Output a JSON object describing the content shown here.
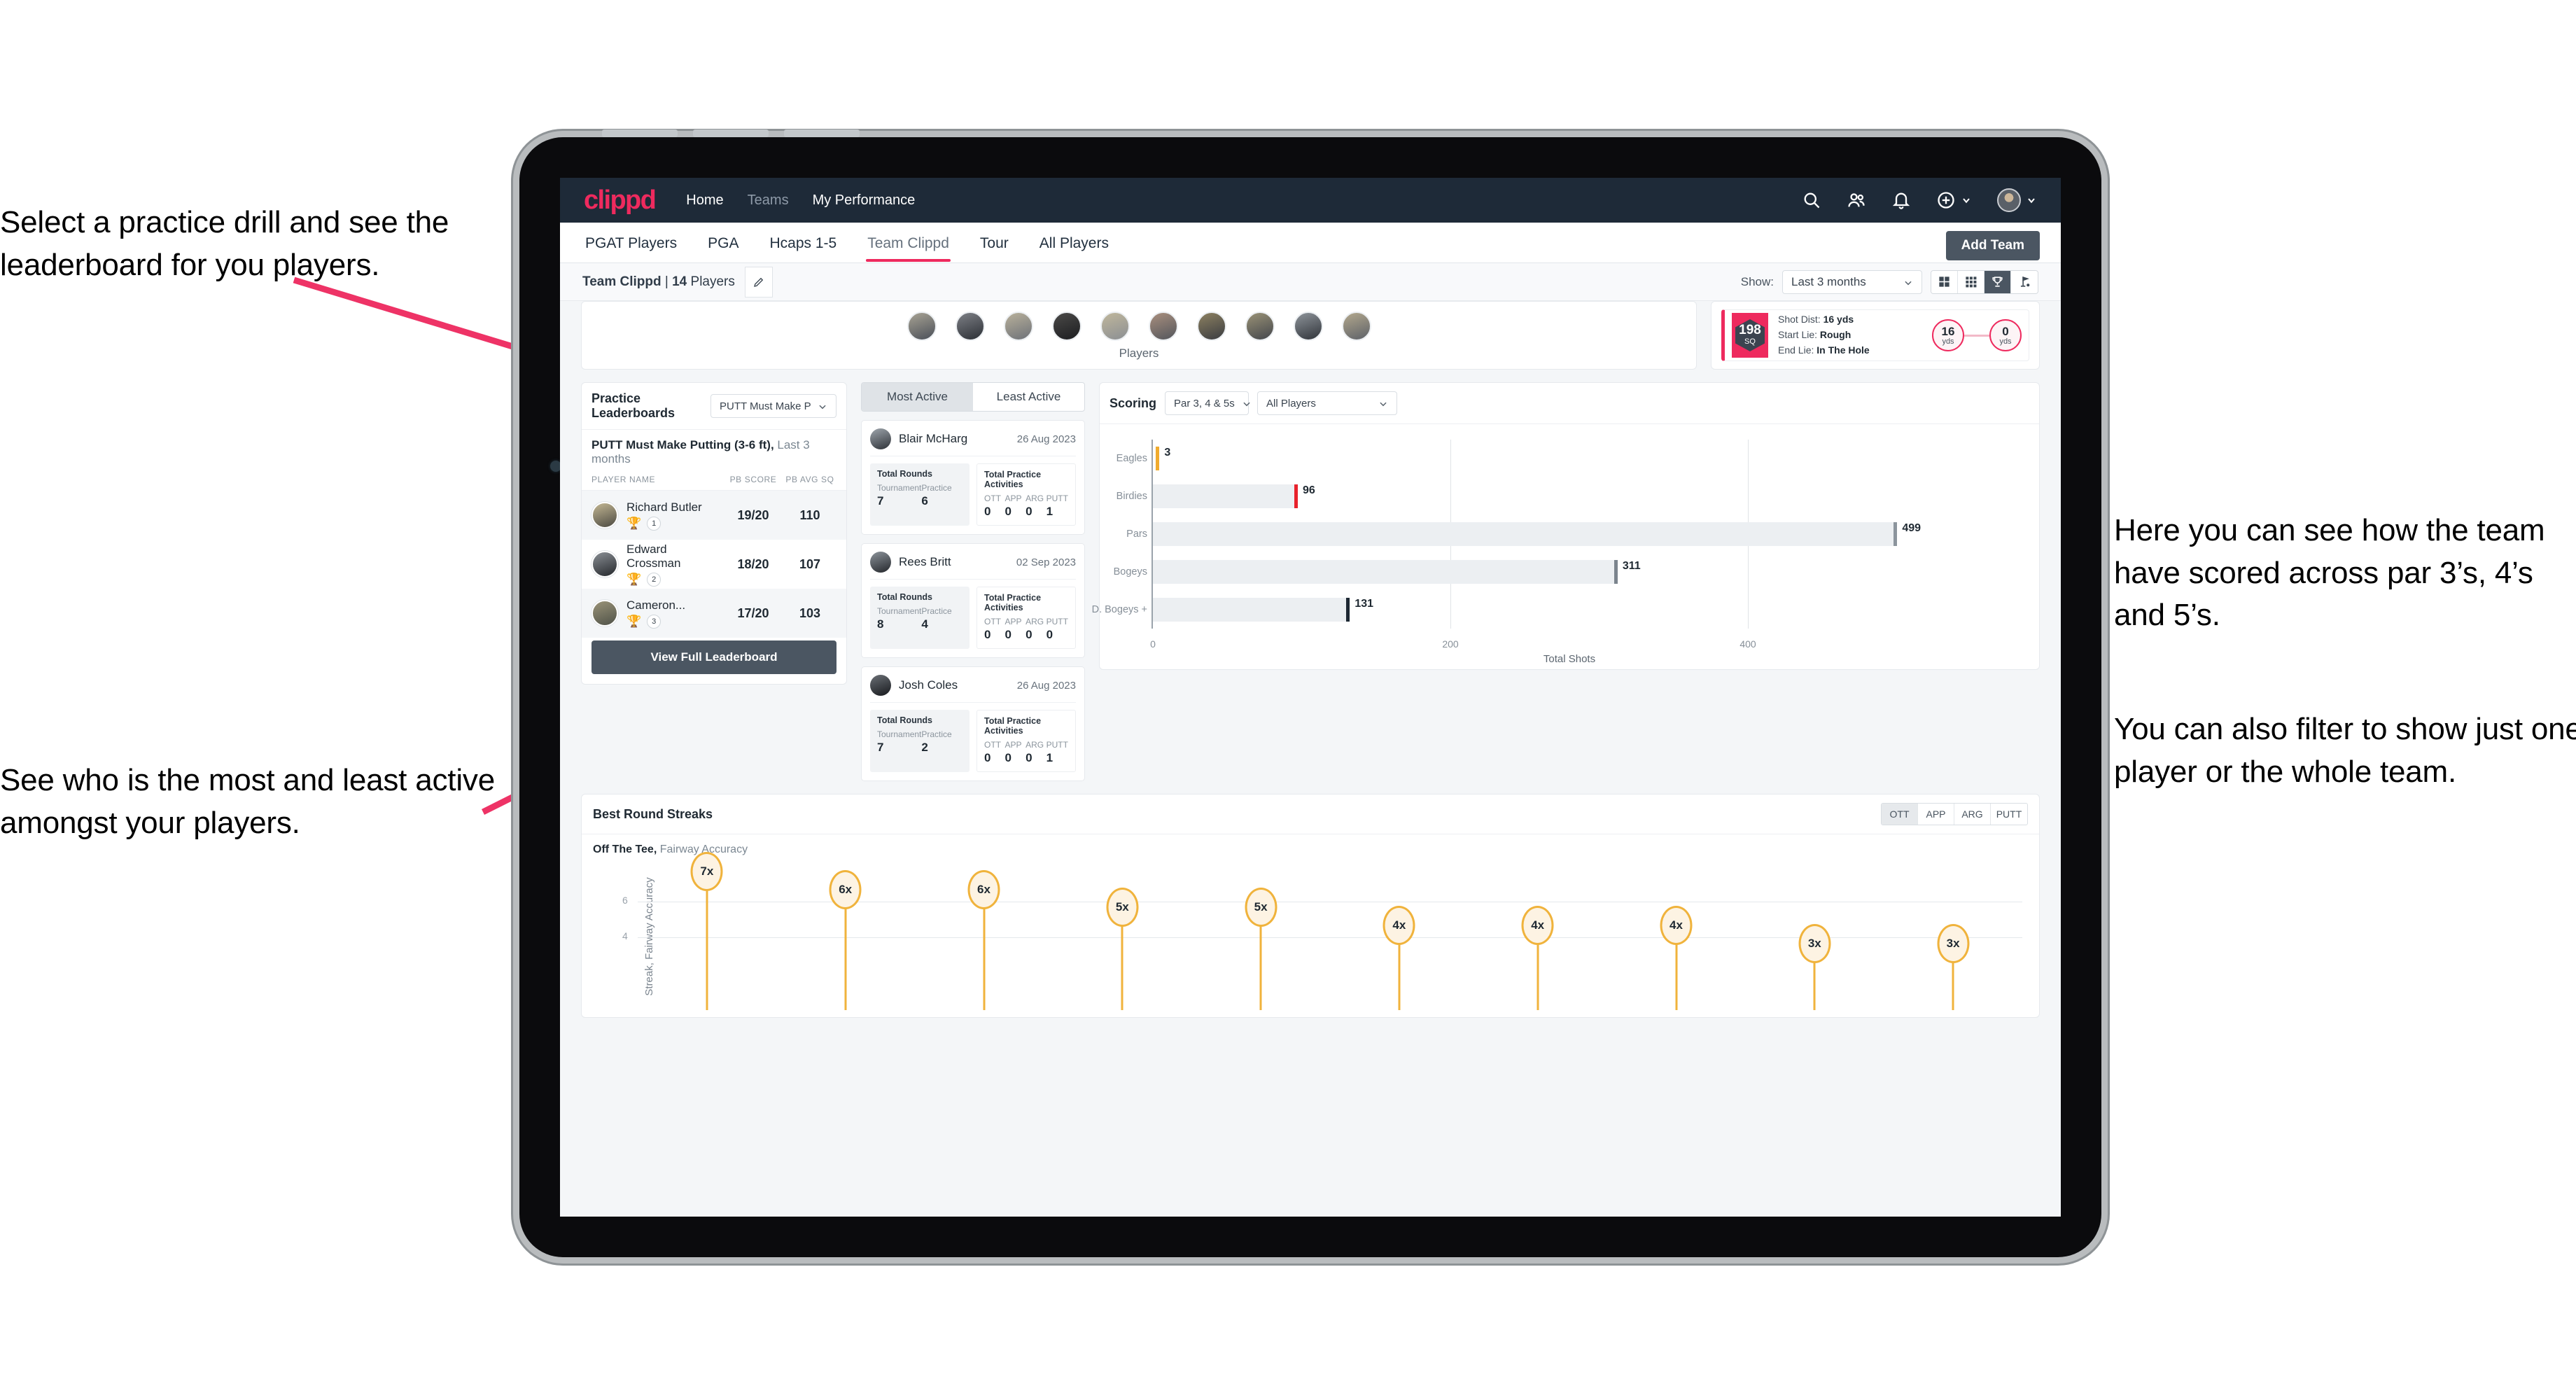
{
  "annotations": {
    "top_left": "Select a practice drill and see the leaderboard for you players.",
    "bottom_left": "See who is the most and least active amongst your players.",
    "right_1": "Here you can see how the team have scored across par 3’s, 4’s and 5’s.",
    "right_2": "You can also filter to show just one player or the whole team."
  },
  "topnav": {
    "logo": "clippd",
    "links": [
      {
        "label": "Home",
        "dim": false
      },
      {
        "label": "Teams",
        "dim": true
      },
      {
        "label": "My Performance",
        "dim": false
      }
    ],
    "icons": [
      "search-icon",
      "people-icon",
      "bell-icon",
      "plus-circle-icon",
      "avatar"
    ]
  },
  "tabs": {
    "items": [
      {
        "label": "PGAT Players",
        "active": false
      },
      {
        "label": "PGA",
        "active": false
      },
      {
        "label": "Hcaps 1-5",
        "active": false
      },
      {
        "label": "Team Clippd",
        "active": true
      },
      {
        "label": "Tour",
        "active": false
      },
      {
        "label": "All Players",
        "active": false
      }
    ],
    "add_team_label": "Add Team"
  },
  "subheader": {
    "team_name": "Team Clippd",
    "separator": " | ",
    "player_count": "14",
    "players_word": " Players",
    "show_label": "Show:",
    "show_value": "Last 3 months",
    "view_toggles": [
      {
        "name": "grid-4-icon",
        "active": false
      },
      {
        "name": "grid-9-icon",
        "active": false
      },
      {
        "name": "trophy-icon",
        "active": true
      },
      {
        "name": "flag-icon",
        "active": false
      }
    ]
  },
  "players_strip": {
    "caption": "Players",
    "count": 10
  },
  "shot_card": {
    "badge_value": "198",
    "badge_unit": "SQ",
    "lines": [
      {
        "label": "Shot Dist: ",
        "value": "16 yds"
      },
      {
        "label": "Start Lie: ",
        "value": "Rough"
      },
      {
        "label": "End Lie: ",
        "value": "In The Hole"
      }
    ],
    "start_yards": "16",
    "start_unit": "yds",
    "end_yards": "0",
    "end_unit": "yds"
  },
  "leaderboard": {
    "title": "Practice Leaderboards",
    "drill_select": "PUTT Must Make Putting ...",
    "subtitle_bold": "PUTT Must Make Putting (3-6 ft),",
    "subtitle_rest": " Last 3 months",
    "columns": [
      "PLAYER NAME",
      "PB SCORE",
      "PB AVG SQ"
    ],
    "rows": [
      {
        "name": "Richard Butler",
        "rank": "1",
        "trophy": "gold",
        "pb_score": "19/20",
        "pb_avg_sq": "110"
      },
      {
        "name": "Edward Crossman",
        "rank": "2",
        "trophy": "silver",
        "pb_score": "18/20",
        "pb_avg_sq": "107"
      },
      {
        "name": "Cameron...",
        "rank": "3",
        "trophy": "bronze",
        "pb_score": "17/20",
        "pb_avg_sq": "103"
      }
    ],
    "button_label": "View Full Leaderboard"
  },
  "activity": {
    "tabs": [
      {
        "label": "Most Active",
        "active": true
      },
      {
        "label": "Least Active",
        "active": false
      }
    ],
    "rounds_title": "Total Rounds",
    "rounds_keys": [
      "Tournament",
      "Practice"
    ],
    "acts_title": "Total Practice Activities",
    "acts_keys": [
      "OTT",
      "APP",
      "ARG",
      "PUTT"
    ],
    "items": [
      {
        "name": "Blair McHarg",
        "date": "26 Aug 2023",
        "rounds": [
          "7",
          "6"
        ],
        "acts": [
          "0",
          "0",
          "0",
          "1"
        ]
      },
      {
        "name": "Rees Britt",
        "date": "02 Sep 2023",
        "rounds": [
          "8",
          "4"
        ],
        "acts": [
          "0",
          "0",
          "0",
          "0"
        ]
      },
      {
        "name": "Josh Coles",
        "date": "26 Aug 2023",
        "rounds": [
          "7",
          "2"
        ],
        "acts": [
          "0",
          "0",
          "0",
          "1"
        ]
      }
    ]
  },
  "scoring": {
    "title": "Scoring",
    "par_select": "Par 3, 4 & 5s",
    "player_select": "All Players"
  },
  "streaks": {
    "title": "Best Round Streaks",
    "toggles": [
      {
        "label": "OTT",
        "active": true
      },
      {
        "label": "APP",
        "active": false
      },
      {
        "label": "ARG",
        "active": false
      },
      {
        "label": "PUTT",
        "active": false
      }
    ],
    "sub_bold": "Off The Tee,",
    "sub_rest": " Fairway Accuracy"
  },
  "chart_data": [
    {
      "type": "bar",
      "orientation": "horizontal",
      "title": "Scoring",
      "categories": [
        "Eagles",
        "Birdies",
        "Pars",
        "Bogeys",
        "D. Bogeys +"
      ],
      "values": [
        3,
        96,
        499,
        311,
        131
      ],
      "cap_colors": [
        "#f0ab2e",
        "#e8222c",
        "#8c959d",
        "#7b848d",
        "#1d2833"
      ],
      "xlabel": "Total Shots",
      "ylabel": "",
      "xlim": [
        0,
        560
      ],
      "xticks": [
        0,
        200,
        400
      ],
      "grid": true,
      "legend": "none"
    },
    {
      "type": "bar",
      "orientation": "vertical-lollipop",
      "title": "Best Round Streaks",
      "subtitle": "Off The Tee, Fairway Accuracy",
      "categories": [
        "1",
        "2",
        "3",
        "4",
        "5",
        "6",
        "7",
        "8",
        "9",
        "10"
      ],
      "values": [
        7,
        6,
        6,
        5,
        5,
        4,
        4,
        4,
        3,
        3
      ],
      "labels": [
        "7x",
        "6x",
        "6x",
        "5x",
        "5x",
        "4x",
        "4x",
        "4x",
        "3x",
        "3x"
      ],
      "ylabel": "Streak, Fairway Accuracy",
      "xlabel": "",
      "ylim": [
        0,
        8
      ],
      "yticks": [
        4,
        6
      ],
      "grid": true,
      "legend": "none",
      "marker_color": "#f0b33c"
    }
  ]
}
